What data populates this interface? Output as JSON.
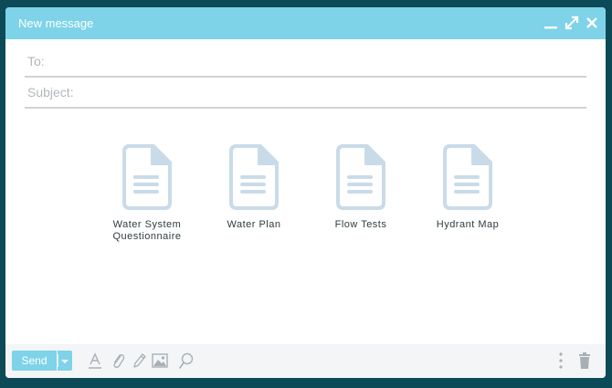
{
  "window": {
    "title": "New message"
  },
  "compose": {
    "to_label": "To:",
    "subject_label": "Subject:"
  },
  "attachments": [
    {
      "label": "Water System Questionnaire"
    },
    {
      "label": "Water Plan"
    },
    {
      "label": "Flow Tests"
    },
    {
      "label": "Hydrant Map"
    }
  ],
  "toolbar": {
    "send_label": "Send"
  },
  "colors": {
    "accent": "#7ed3e8",
    "background": "#0d4a58",
    "doc_icon": "#c9dbe8",
    "tool_icon": "#a9b0b5"
  },
  "icons": {
    "minimize": "minimize-icon",
    "expand": "expand-icon",
    "close": "close-icon",
    "document": "document-icon",
    "format": "text-format-icon",
    "attach": "paperclip-icon",
    "pen": "pen-icon",
    "image": "image-icon",
    "link": "link-icon",
    "more": "more-vertical-icon",
    "trash": "trash-icon"
  }
}
